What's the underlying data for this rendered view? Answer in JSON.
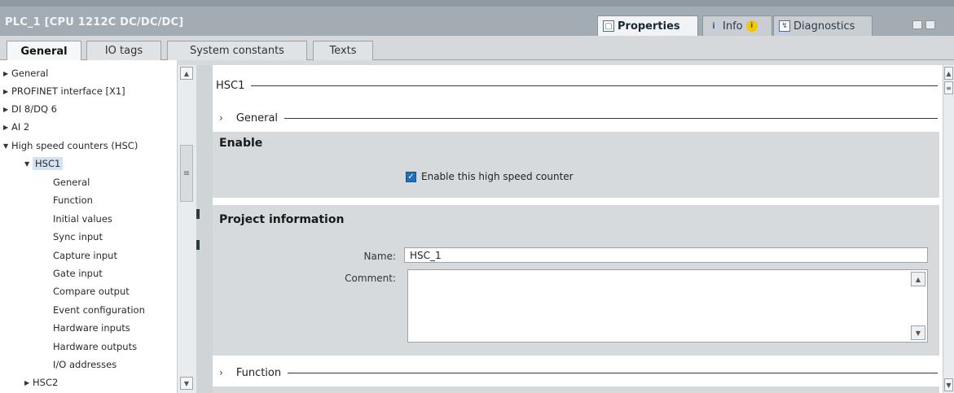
{
  "window": {
    "title": "PLC_1 [CPU 1212C DC/DC/DC]",
    "panel_tabs": [
      {
        "label": "Properties",
        "icon": "properties-icon",
        "active": true
      },
      {
        "label": "Info",
        "icon": "info-icon",
        "badge_icon": "warning-icon"
      },
      {
        "label": "Diagnostics",
        "icon": "diagnostics-icon"
      }
    ]
  },
  "tabs": [
    "General",
    "IO tags",
    "System constants",
    "Texts"
  ],
  "tree": {
    "items": [
      {
        "label": "General"
      },
      {
        "label": "PROFINET interface [X1]"
      },
      {
        "label": "DI 8/DQ 6"
      },
      {
        "label": "AI 2"
      },
      {
        "label": "High speed counters (HSC)"
      },
      {
        "label": "HSC1"
      },
      {
        "label": "General"
      },
      {
        "label": "Function"
      },
      {
        "label": "Initial values"
      },
      {
        "label": "Sync input"
      },
      {
        "label": "Capture input"
      },
      {
        "label": "Gate input"
      },
      {
        "label": "Compare output"
      },
      {
        "label": "Event configuration"
      },
      {
        "label": "Hardware inputs"
      },
      {
        "label": "Hardware outputs"
      },
      {
        "label": "I/O addresses"
      },
      {
        "label": "HSC2"
      }
    ]
  },
  "main": {
    "section_title": "HSC1",
    "general_header": "General",
    "enable": {
      "title": "Enable",
      "checkbox_label": "Enable this high speed counter",
      "checked": true
    },
    "project_info": {
      "title": "Project information",
      "name_label": "Name:",
      "name_value": "HSC_1",
      "comment_label": "Comment:",
      "comment_value": ""
    },
    "function_header": "Function"
  },
  "colors": {
    "accent": "#1f6fc1",
    "panel_bg": "#d6dadd",
    "title_bar": "#a3acb2"
  }
}
